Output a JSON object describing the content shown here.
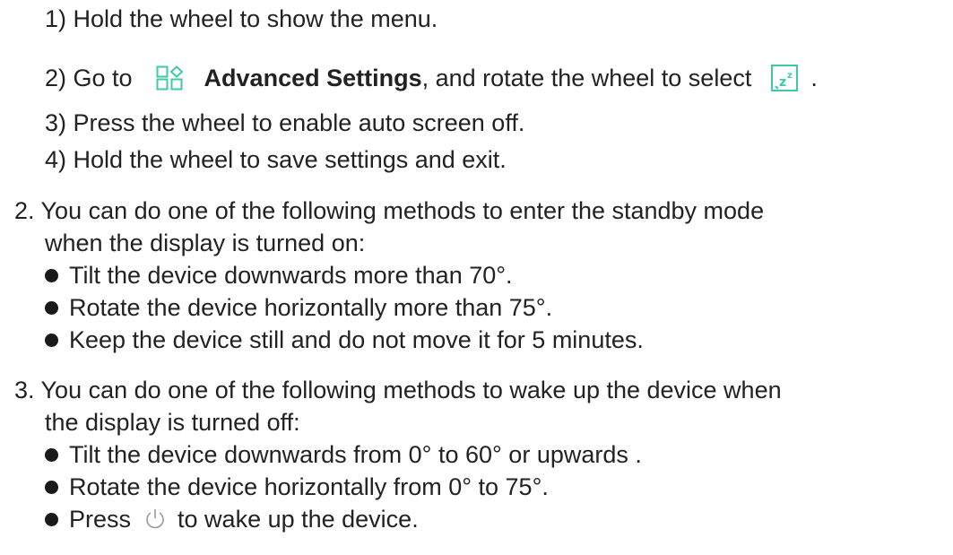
{
  "substeps": [
    {
      "text": "1) Hold the wheel to show the menu."
    },
    {
      "prefix": "2) Go to",
      "icon1": "advanced-settings-icon",
      "bold": "Advanced Settings",
      "middle": ", and rotate the wheel to select",
      "icon2": "auto-screen-off-icon",
      "suffix": "."
    },
    {
      "text": "3) Press the wheel to enable auto screen off."
    },
    {
      "text": "4) Hold the wheel to save settings and exit."
    }
  ],
  "item2": {
    "line1": "2. You can do one of the following methods to enter the standby mode",
    "line2": "when the display is turned on:",
    "bullets": [
      "Tilt the device downwards more than 70°.",
      "Rotate the device horizontally more than 75°.",
      "Keep the device still and do not move it for 5 minutes."
    ]
  },
  "item3": {
    "line1": "3. You can do one of the following methods to wake up the device when",
    "line2": "the display is turned off:",
    "bullets": [
      "Tilt the device downwards from 0° to 60° or upwards .",
      "Rotate the device horizontally from 0° to 75°."
    ],
    "last_bullet": {
      "prefix": "Press",
      "icon": "power-icon",
      "suffix": "to wake up the device."
    }
  },
  "colors": {
    "text": "#222222",
    "icon_accent": "#3ec9a7"
  }
}
